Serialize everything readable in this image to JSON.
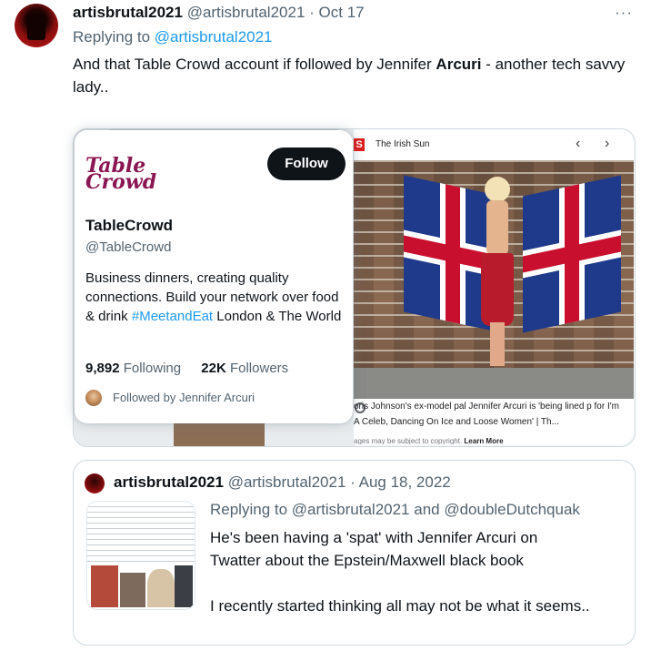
{
  "tweet": {
    "author_name": "artisbrutal2021",
    "author_handle": "@artisbrutal2021",
    "separator": "·",
    "time": "Oct 17",
    "more_label": "···",
    "replying_prefix": "Replying to",
    "replying_to": "@artisbrutal2021",
    "text_before": "And that Table Crowd account if followed by Jennifer ",
    "text_bold": "Arcuri",
    "text_after": " - another tech savvy lady.."
  },
  "profile_card": {
    "logo_line1": "Table",
    "logo_line2": "Crowd",
    "follow_label": "Follow",
    "name": "TableCrowd",
    "handle": "@TableCrowd",
    "bio_before": "Business dinners, creating quality connections. Build your network over food & drink ",
    "bio_hashtag": "#MeetandEat",
    "bio_after": " London & The World",
    "following_count": "9,892",
    "following_label": "Following",
    "followers_count": "22K",
    "followers_label": "Followers",
    "followed_by": "Followed by Jennifer Arcuri"
  },
  "image_panel": {
    "source_logo": "S",
    "source_name": "The Irish Sun",
    "prev_icon": "‹",
    "next_icon": "›",
    "caption": "oris Johnson's ex-model pal Jennifer Arcuri is 'being lined p for I'm A Celeb, Dancing On Ice and Loose Women' | Th...",
    "copyright": "ages may be subject to copyright.",
    "learn_more": "Learn More"
  },
  "quote": {
    "author_name": "artisbrutal2021",
    "author_handle": "@artisbrutal2021",
    "separator": "·",
    "time": "Aug 18, 2022",
    "replying_prefix": "Replying to",
    "replying_to": "@artisbrutal2021 and @doubleDutchquak",
    "para1": "He's been having a 'spat' with Jennifer Arcuri on Twatter about the Epstein/Maxwell black book",
    "para2": "I recently started thinking all may not be what it seems.."
  },
  "colors": {
    "link": "#1d9bf0",
    "muted": "#536471",
    "text": "#0f1419",
    "logo": "#8a1652"
  }
}
